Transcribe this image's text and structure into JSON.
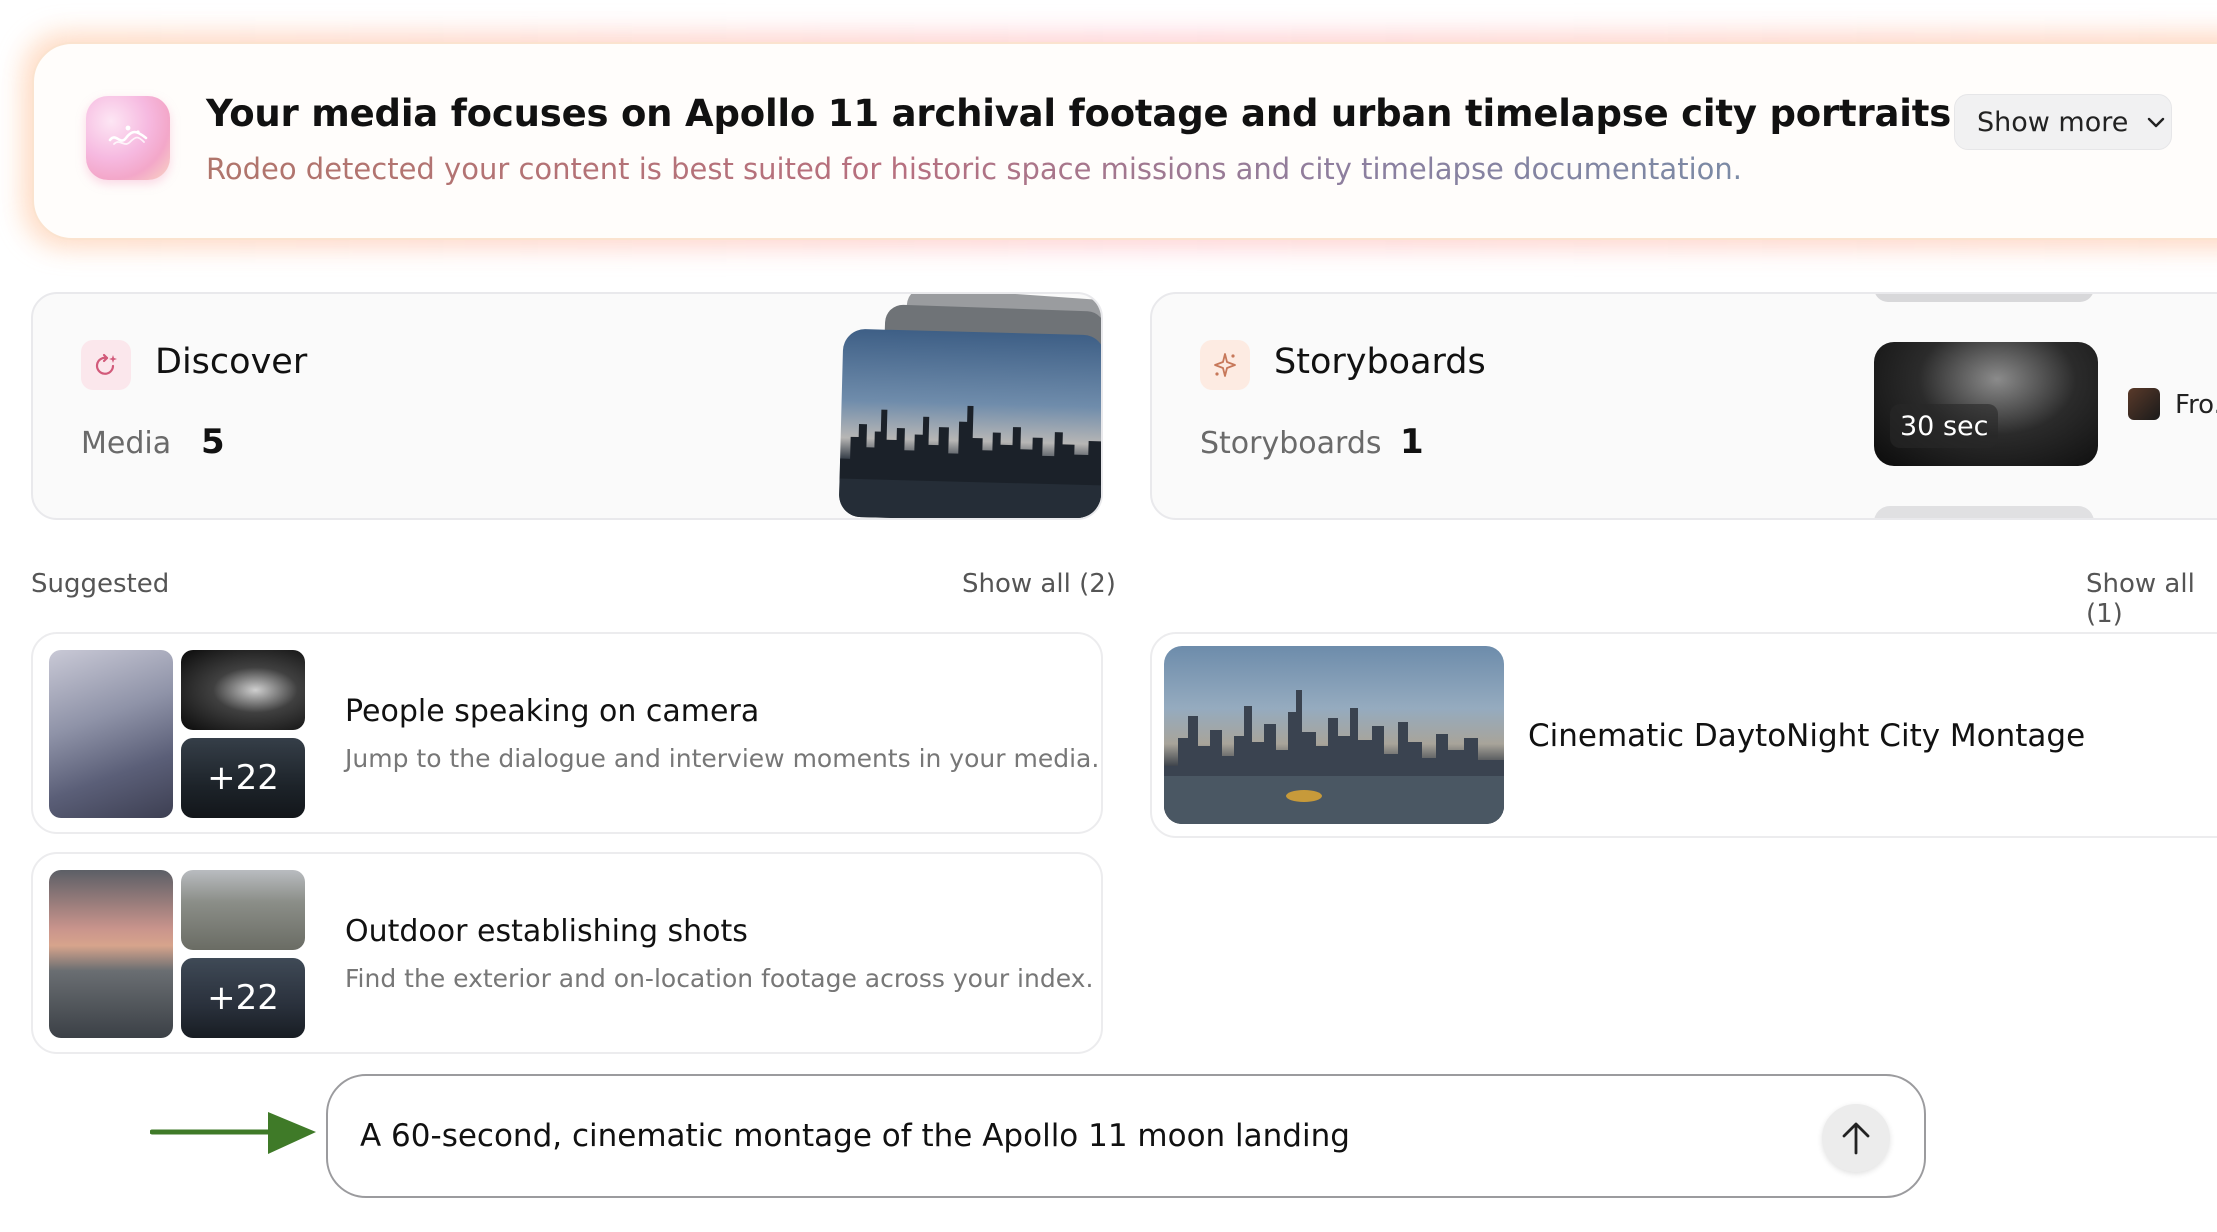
{
  "insight_banner": {
    "title": "Your media focuses on Apollo 11 archival footage and urban timelapse city portraits",
    "subtitle": "Rodeo detected your content is best suited for historic space missions and city timelapse documentation.",
    "show_more_label": "Show more",
    "icon": "sparkle-wave-icon"
  },
  "discover_card": {
    "title": "Discover",
    "icon": "refresh-sparkle-icon",
    "stat_label": "Media",
    "stat_value": "5"
  },
  "storyboards_card": {
    "title": "Storyboards",
    "icon": "sparkle-stars-icon",
    "stat_label": "Storyboards",
    "stat_value": "1",
    "clip_duration": "30 sec",
    "peek_text": "Fro..."
  },
  "suggested_section": {
    "label": "Suggested",
    "show_all_label": "Show all (2)",
    "items": [
      {
        "title": "People speaking on camera",
        "description": "Jump to the dialogue and interview moments in your media.",
        "more_count": "+22"
      },
      {
        "title": "Outdoor establishing shots",
        "description": "Find the exterior and on-location footage across your index.",
        "more_count": "+22"
      }
    ]
  },
  "storyboards_section": {
    "show_all_label": "Show all (1)",
    "items": [
      {
        "title": "Cinematic DaytoNight City Montage"
      }
    ]
  },
  "prompt_bar": {
    "value": "A 60-second, cinematic montage of the Apollo 11 moon landing",
    "send_icon": "arrow-up-icon"
  },
  "annotation": {
    "icon": "green-arrow-pointer-icon",
    "color": "#3f7a28"
  }
}
